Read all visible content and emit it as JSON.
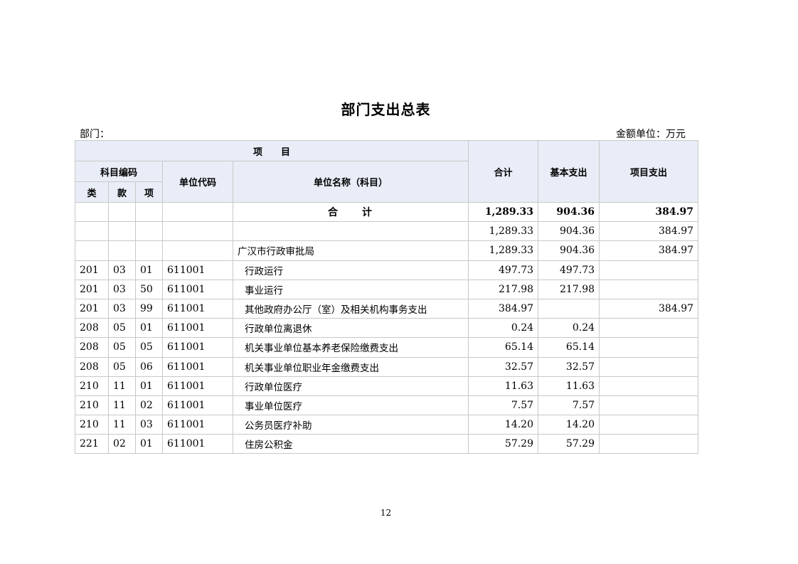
{
  "title": "部门支出总表",
  "dept_label": "部门：",
  "unit_label": "金额单位：万元",
  "header": {
    "project": "项　　目",
    "subject_code": "科目编码",
    "lei": "类",
    "kuan": "款",
    "xiang": "项",
    "unit_code": "单位代码",
    "unit_name": "单位名称（科目）",
    "total": "合计",
    "basic": "基本支出",
    "project_exp": "项目支出"
  },
  "total_row": {
    "label": "合　　计",
    "total": "1,289.33",
    "basic": "904.36",
    "project": "384.97"
  },
  "rows": [
    {
      "lei": "",
      "kuan": "",
      "xiang": "",
      "code": "",
      "name": "",
      "total": "1,289.33",
      "basic": "904.36",
      "project": "384.97"
    },
    {
      "lei": "",
      "kuan": "",
      "xiang": "",
      "code": "",
      "name": "广汉市行政审批局",
      "total": "1,289.33",
      "basic": "904.36",
      "project": "384.97"
    },
    {
      "lei": "201",
      "kuan": "03",
      "xiang": "01",
      "code": "611001",
      "name": "行政运行",
      "total": "497.73",
      "basic": "497.73",
      "project": ""
    },
    {
      "lei": "201",
      "kuan": "03",
      "xiang": "50",
      "code": "611001",
      "name": "事业运行",
      "total": "217.98",
      "basic": "217.98",
      "project": ""
    },
    {
      "lei": "201",
      "kuan": "03",
      "xiang": "99",
      "code": "611001",
      "name": "其他政府办公厅（室）及相关机构事务支出",
      "total": "384.97",
      "basic": "",
      "project": "384.97"
    },
    {
      "lei": "208",
      "kuan": "05",
      "xiang": "01",
      "code": "611001",
      "name": "行政单位离退休",
      "total": "0.24",
      "basic": "0.24",
      "project": ""
    },
    {
      "lei": "208",
      "kuan": "05",
      "xiang": "05",
      "code": "611001",
      "name": "机关事业单位基本养老保险缴费支出",
      "total": "65.14",
      "basic": "65.14",
      "project": ""
    },
    {
      "lei": "208",
      "kuan": "05",
      "xiang": "06",
      "code": "611001",
      "name": "机关事业单位职业年金缴费支出",
      "total": "32.57",
      "basic": "32.57",
      "project": ""
    },
    {
      "lei": "210",
      "kuan": "11",
      "xiang": "01",
      "code": "611001",
      "name": "行政单位医疗",
      "total": "11.63",
      "basic": "11.63",
      "project": ""
    },
    {
      "lei": "210",
      "kuan": "11",
      "xiang": "02",
      "code": "611001",
      "name": "事业单位医疗",
      "total": "7.57",
      "basic": "7.57",
      "project": ""
    },
    {
      "lei": "210",
      "kuan": "11",
      "xiang": "03",
      "code": "611001",
      "name": "公务员医疗补助",
      "total": "14.20",
      "basic": "14.20",
      "project": ""
    },
    {
      "lei": "221",
      "kuan": "02",
      "xiang": "01",
      "code": "611001",
      "name": "住房公积金",
      "total": "57.29",
      "basic": "57.29",
      "project": ""
    }
  ],
  "page_number": "12"
}
